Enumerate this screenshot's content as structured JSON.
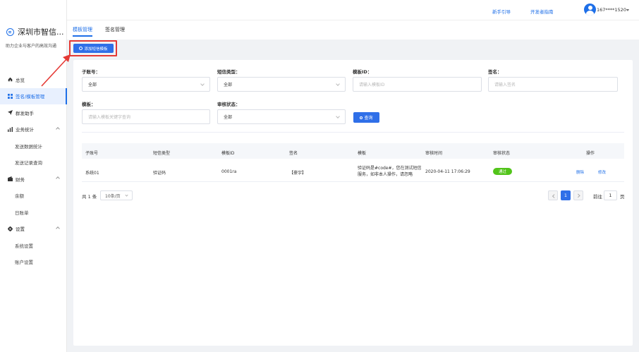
{
  "brand": {
    "name": "深圳市智信...",
    "slogan": "助力企业与客户的高效沟通"
  },
  "sidebar": {
    "items": [
      {
        "label": "总览",
        "icon": "home-icon"
      },
      {
        "label": "签名/模板管理",
        "icon": "grid-icon",
        "active": true
      },
      {
        "label": "群发助手",
        "icon": "send-icon"
      },
      {
        "label": "业务统计",
        "icon": "bar-chart-icon",
        "expandable": true
      },
      {
        "label": "发送数据统计",
        "sub": true
      },
      {
        "label": "发送记录查询",
        "sub": true
      },
      {
        "label": "财务",
        "icon": "wallet-icon",
        "expandable": true
      },
      {
        "label": "余额",
        "sub": true
      },
      {
        "label": "日账单",
        "sub": true
      },
      {
        "label": "设置",
        "icon": "gear-icon",
        "expandable": true
      },
      {
        "label": "系统设置",
        "sub": true
      },
      {
        "label": "账户设置",
        "sub": true
      }
    ]
  },
  "topbar": {
    "guide": "新手引导",
    "dev_guide": "开发者指南",
    "user_phone": "167****1520"
  },
  "tabs": [
    {
      "label": "模板管理",
      "active": true
    },
    {
      "label": "签名管理"
    }
  ],
  "add_button": "添加短信模板",
  "filters": {
    "sub_account": {
      "label": "子账号：",
      "value": "全部"
    },
    "sms_type": {
      "label": "短信类型：",
      "value": "全部"
    },
    "template_id": {
      "label": "模板ID：",
      "placeholder": "请输入模板ID"
    },
    "signature": {
      "label": "签名：",
      "placeholder": "请输入签名"
    },
    "template": {
      "label": "模板：",
      "placeholder": "请输入模板关键字查询"
    },
    "audit_status": {
      "label": "审核状态：",
      "value": "全部"
    },
    "query_button": "查询"
  },
  "table": {
    "headers": [
      "子账号",
      "短信类型",
      "模板ID",
      "签名",
      "模板",
      "审核时间",
      "审核状态",
      "操作"
    ],
    "rows": [
      {
        "sub_account": "系统01",
        "sms_type": "验证码",
        "template_id": "0001ra",
        "signature": "【豪宇】",
        "template": "验证码是#code#，您在测试短信服务，如非本人操作，请忽略",
        "audit_time": "2020-04-11 17:06:29",
        "audit_status": "通过",
        "op_delete": "删除",
        "op_edit": "修改"
      }
    ]
  },
  "pagination": {
    "total": "共 1 条",
    "page_size": "10条/页",
    "current": "1",
    "goto_label": "前往",
    "goto_value": "1",
    "page_suffix": "页"
  },
  "colors": {
    "primary": "#2f6fe8",
    "success": "#52c41a",
    "highlight": "#e53935"
  }
}
